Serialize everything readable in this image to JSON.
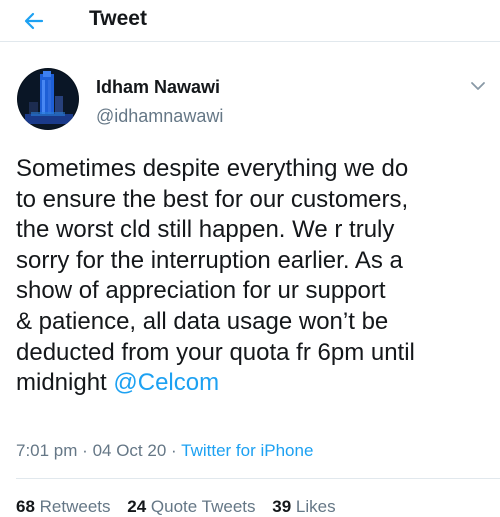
{
  "header": {
    "title": "Tweet",
    "back_icon": "arrow-left-icon",
    "accent_color": "#1da1f2"
  },
  "author": {
    "display_name": "Idham Nawawi",
    "handle": "@idhamnawawi",
    "avatar_icon": "profile-photo-tower-icon"
  },
  "tweet": {
    "text": "Sometimes despite everything we do\nto ensure the best for our customers,\nthe worst cld still happen. We r truly\nsorry for the interruption earlier. As a\nshow of appreciation for ur support\n& patience, all data usage won’t be\ndeducted from your quota fr 6pm until\nmidnight ",
    "mention": "@Celcom",
    "time": "7:01 pm",
    "date": "04 Oct 20",
    "source": "Twitter for iPhone",
    "separator": "·"
  },
  "stats": {
    "retweets_count": "68",
    "retweets_label": "Retweets",
    "quotes_count": "24",
    "quotes_label": "Quote Tweets",
    "likes_count": "39",
    "likes_label": "Likes"
  }
}
